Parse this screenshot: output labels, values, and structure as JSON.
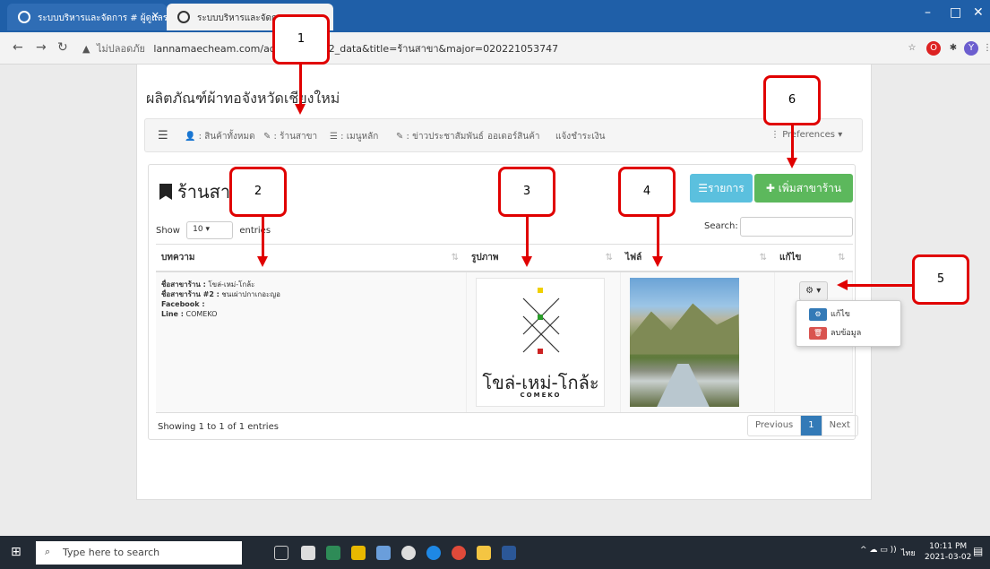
{
  "browser": {
    "tabs": [
      {
        "title": "ระบบบริหารและจัดการ # ผู้ดูแลระบบ"
      },
      {
        "title": "ระบบบริหารและจัดการ #"
      }
    ],
    "address": {
      "security_label": "ไม่ปลอดภัย",
      "url": "lannamaecheam.com/adnoc...ws442_data&title=ร้านสาขา&major=020221053747"
    }
  },
  "page": {
    "title": "ผลิตภัณฑ์ผ้าทอจังหวัดเชียงใหม่",
    "nav": {
      "items": [
        {
          "label": "สินค้าทั้งหมด"
        },
        {
          "label": "ร้านสาขา"
        },
        {
          "label": "เมนูหลัก"
        },
        {
          "label": "ข่าวประชาสัมพันธ์"
        },
        {
          "label": "ออเดอร์สินค้า"
        },
        {
          "label": "แจ้งชำระเงิน"
        }
      ],
      "preferences": "Preferences"
    },
    "box": {
      "title": "ร้านสา",
      "btn_list": "รายการ",
      "btn_add": "เพิ่มสาขาร้าน",
      "show_label": "Show",
      "entries_value": "10",
      "entries_label": "entries",
      "search_label": "Search:",
      "columns": [
        "บทความ",
        "รูปภาพ",
        "ไฟล์",
        "แก้ไข"
      ],
      "row": {
        "line1_label": "ชื่อสาขาร้าน :",
        "line1_value": "โขล่-เหม่-โกล้ะ",
        "line2_label": "ชื่อสาขาร้าน #2 :",
        "line2_value": "ชนเผ่าปกาเกอะญอ",
        "line3_label": "Facebook :",
        "line4_label": "Line :",
        "line4_value": "COMEKO",
        "logo_text": "โขล่-เหม่-โกล้ะ",
        "logo_sub": "COMEKO"
      },
      "dropdown": {
        "edit": "แก้ไข",
        "delete": "ลบข้อมูล"
      },
      "showing": "Showing 1 to 1 of 1 entries",
      "pager": {
        "prev": "Previous",
        "page": "1",
        "next": "Next"
      }
    }
  },
  "callouts": [
    "1",
    "2",
    "3",
    "4",
    "5",
    "6"
  ],
  "taskbar": {
    "search_placeholder": "Type here to search",
    "time": "10:11 PM",
    "date": "2021-03-02",
    "lang": "ไทย"
  }
}
